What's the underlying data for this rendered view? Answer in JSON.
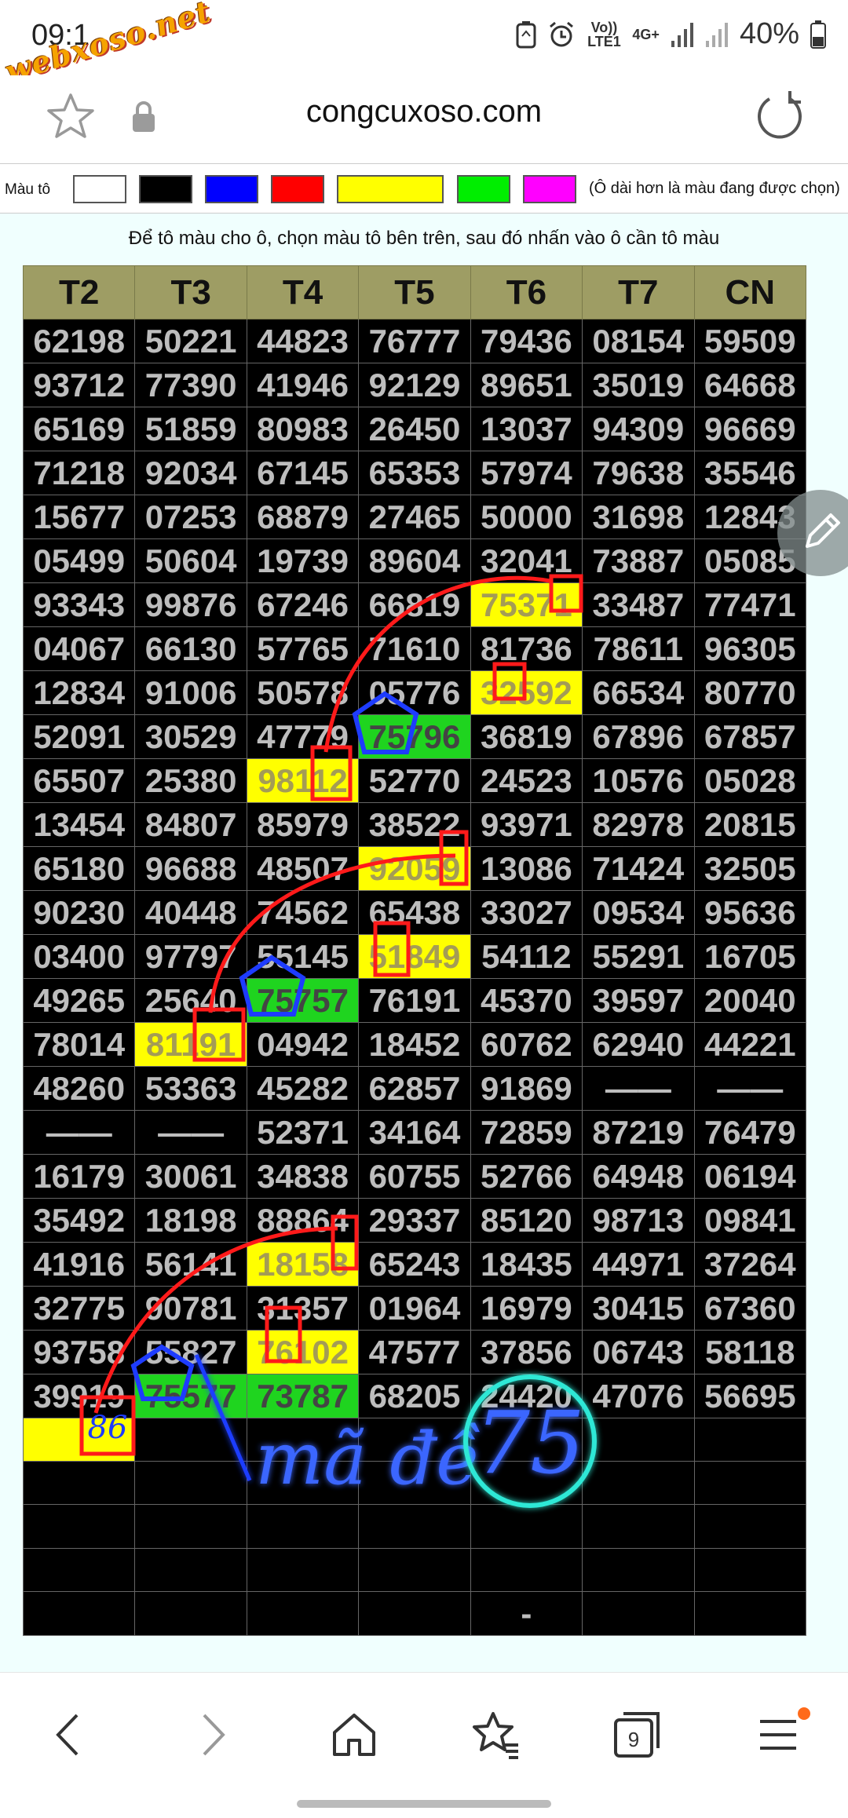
{
  "status_bar": {
    "time": "09:1",
    "watermark": "webxoso.net",
    "volte": "Vo)) LTE1",
    "network": "4G+",
    "battery": "40%"
  },
  "browser": {
    "url": "congcuxoso.com"
  },
  "color_picker": {
    "label": "Màu tô",
    "swatches": [
      "#ffffff",
      "#000000",
      "#0000ff",
      "#ff0000",
      "#ffff00",
      "#00ee00",
      "#ff00ff"
    ],
    "note": "(Ô dài hơn là màu đang được chọn)"
  },
  "instruction": "Để tô màu cho ô, chọn màu tô bên trên, sau đó nhấn vào ô cần tô màu",
  "table": {
    "headers": [
      "T2",
      "T3",
      "T4",
      "T5",
      "T6",
      "T7",
      "CN"
    ],
    "rows": [
      [
        "62198",
        "50221",
        "44823",
        "76777",
        "79436",
        "08154",
        "59509"
      ],
      [
        "93712",
        "77390",
        "41946",
        "92129",
        "89651",
        "35019",
        "64668"
      ],
      [
        "65169",
        "51859",
        "80983",
        "26450",
        "13037",
        "94309",
        "96669"
      ],
      [
        "71218",
        "92034",
        "67145",
        "65353",
        "57974",
        "79638",
        "35546"
      ],
      [
        "15677",
        "07253",
        "68879",
        "27465",
        "50000",
        "31698",
        "12843"
      ],
      [
        "05499",
        "50604",
        "19739",
        "89604",
        "32041",
        "73887",
        "05085"
      ],
      [
        "93343",
        "99876",
        "67246",
        "66819",
        "75371",
        "33487",
        "77471"
      ],
      [
        "04067",
        "66130",
        "57765",
        "71610",
        "81736",
        "78611",
        "96305"
      ],
      [
        "12834",
        "91006",
        "50578",
        "05776",
        "32592",
        "66534",
        "80770"
      ],
      [
        "52091",
        "30529",
        "47779",
        "75796",
        "36819",
        "67896",
        "67857"
      ],
      [
        "65507",
        "25380",
        "98112",
        "52770",
        "24523",
        "10576",
        "05028"
      ],
      [
        "13454",
        "84807",
        "85979",
        "38522",
        "93971",
        "82978",
        "20815"
      ],
      [
        "65180",
        "96688",
        "48507",
        "92059",
        "13086",
        "71424",
        "32505"
      ],
      [
        "90230",
        "40448",
        "74562",
        "65438",
        "33027",
        "09534",
        "95636"
      ],
      [
        "03400",
        "97797",
        "55145",
        "51849",
        "54112",
        "55291",
        "16705"
      ],
      [
        "49265",
        "25640",
        "75757",
        "76191",
        "45370",
        "39597",
        "20040"
      ],
      [
        "78014",
        "81191",
        "04942",
        "18452",
        "60762",
        "62940",
        "44221"
      ],
      [
        "48260",
        "53363",
        "45282",
        "62857",
        "91869",
        "——",
        "——"
      ],
      [
        "——",
        "——",
        "52371",
        "34164",
        "72859",
        "87219",
        "76479"
      ],
      [
        "16179",
        "30061",
        "34838",
        "60755",
        "52766",
        "64948",
        "06194"
      ],
      [
        "35492",
        "18198",
        "88864",
        "29337",
        "85120",
        "98713",
        "09841"
      ],
      [
        "41916",
        "56141",
        "18158",
        "65243",
        "18435",
        "44971",
        "37264"
      ],
      [
        "32775",
        "90781",
        "31357",
        "01964",
        "16979",
        "30415",
        "67360"
      ],
      [
        "93758",
        "55827",
        "76102",
        "47577",
        "37856",
        "06743",
        "58118"
      ],
      [
        "39919",
        "75577",
        "73787",
        "68205",
        "24420",
        "47076",
        "56695"
      ],
      [
        "",
        "",
        "",
        "",
        "",
        "",
        ""
      ],
      [
        "",
        "",
        "",
        "",
        "",
        "",
        ""
      ],
      [
        "",
        "",
        "",
        "",
        "",
        "",
        ""
      ],
      [
        "",
        "",
        "",
        "",
        "",
        "",
        ""
      ],
      [
        "",
        "",
        "",
        "",
        "-",
        "",
        ""
      ]
    ],
    "yellow_cells": [
      [
        6,
        4
      ],
      [
        8,
        4
      ],
      [
        10,
        2
      ],
      [
        12,
        3
      ],
      [
        14,
        3
      ],
      [
        16,
        1
      ],
      [
        21,
        2
      ],
      [
        23,
        2
      ],
      [
        25,
        0
      ]
    ],
    "green_cells": [
      [
        9,
        3
      ],
      [
        15,
        2
      ],
      [
        24,
        1
      ],
      [
        24,
        2
      ]
    ]
  },
  "annotations": {
    "marked_number": "86",
    "handwritten_note": "mã đề",
    "circled_number": "75"
  }
}
